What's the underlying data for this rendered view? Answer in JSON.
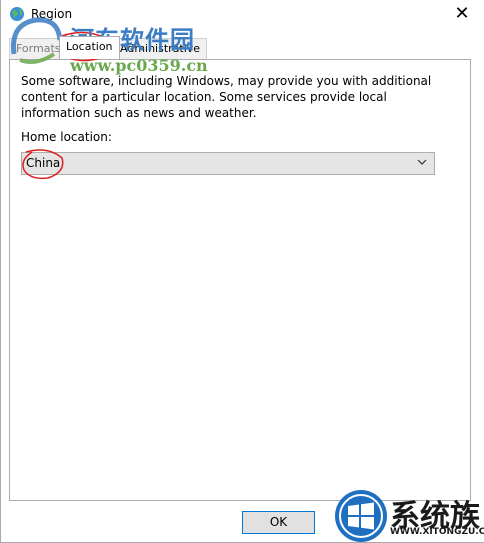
{
  "window": {
    "title": "Region",
    "close_glyph": "✕"
  },
  "tabs": [
    {
      "label": "Formats",
      "active": false
    },
    {
      "label": "Location",
      "active": true
    },
    {
      "label": "Administrative",
      "active": false
    }
  ],
  "location": {
    "description": "Some software, including Windows, may provide you with additional content for a particular location. Some services provide local information such as news and weather.",
    "home_label": "Home location:",
    "home_value": "China"
  },
  "footer": {
    "ok_label": "OK"
  },
  "watermarks": {
    "top_text": "河东软件园",
    "top_url": "www.pc0359.cn",
    "bottom_text": "系统族",
    "bottom_url": "WWW.XITONGZU.COM"
  },
  "colors": {
    "accent": "#0078d7",
    "annotation": "#e02020"
  }
}
